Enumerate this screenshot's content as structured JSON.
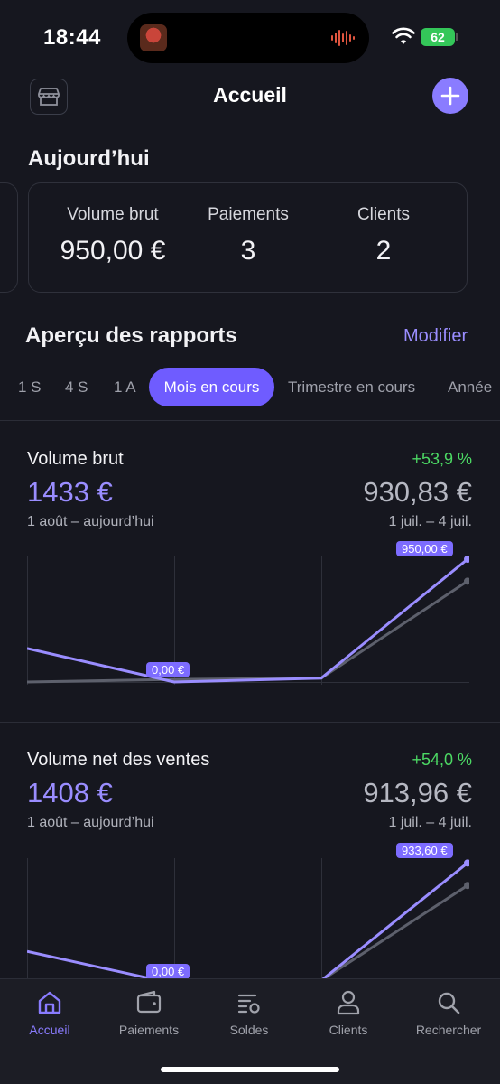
{
  "status_bar": {
    "time": "18:44",
    "battery": "62"
  },
  "header": {
    "title": "Accueil",
    "icons": {
      "shop": "storefront-icon",
      "add": "plus-icon"
    }
  },
  "today": {
    "title": "Aujourd’hui",
    "stats": [
      {
        "label": "Volume brut",
        "value": "950,00 €"
      },
      {
        "label": "Paiements",
        "value": "3"
      },
      {
        "label": "Clients",
        "value": "2"
      }
    ]
  },
  "reports": {
    "title": "Aperçu des rapports",
    "modify": "Modifier",
    "tabs": [
      "1 S",
      "4 S",
      "1 A",
      "Mois en cours",
      "Trimestre en cours",
      "Année"
    ],
    "active_tab": "Mois en cours"
  },
  "metrics": [
    {
      "title": "Volume brut",
      "change": "+53,9 %",
      "value": "1433 €",
      "previous": "930,83 €",
      "period": "1 août – aujourd’hui",
      "previous_period": "1 juil. – 4 juil.",
      "label_high": "950,00 €",
      "label_low": "0,00 €",
      "current_series": [
        260,
        0,
        30,
        950
      ],
      "previous_series": [
        0,
        20,
        30,
        780
      ]
    },
    {
      "title": "Volume net des ventes",
      "change": "+54,0 %",
      "value": "1408 €",
      "previous": "913,96 €",
      "period": "1 août – aujourd’hui",
      "previous_period": "1 juil. – 4 juil.",
      "label_high": "933,60 €",
      "label_low": "0,00 €",
      "current_series": [
        250,
        0,
        25,
        933.6
      ],
      "previous_series": [
        0,
        10,
        25,
        760
      ]
    }
  ],
  "colors": {
    "accent": "#8a7cff",
    "positive": "#4cd964",
    "background": "#16171f"
  },
  "nav": [
    {
      "label": "Accueil",
      "icon": "home-icon",
      "active": true
    },
    {
      "label": "Paiements",
      "icon": "wallet-icon",
      "active": false
    },
    {
      "label": "Soldes",
      "icon": "balances-icon",
      "active": false
    },
    {
      "label": "Clients",
      "icon": "person-icon",
      "active": false
    },
    {
      "label": "Rechercher",
      "icon": "search-icon",
      "active": false
    }
  ]
}
